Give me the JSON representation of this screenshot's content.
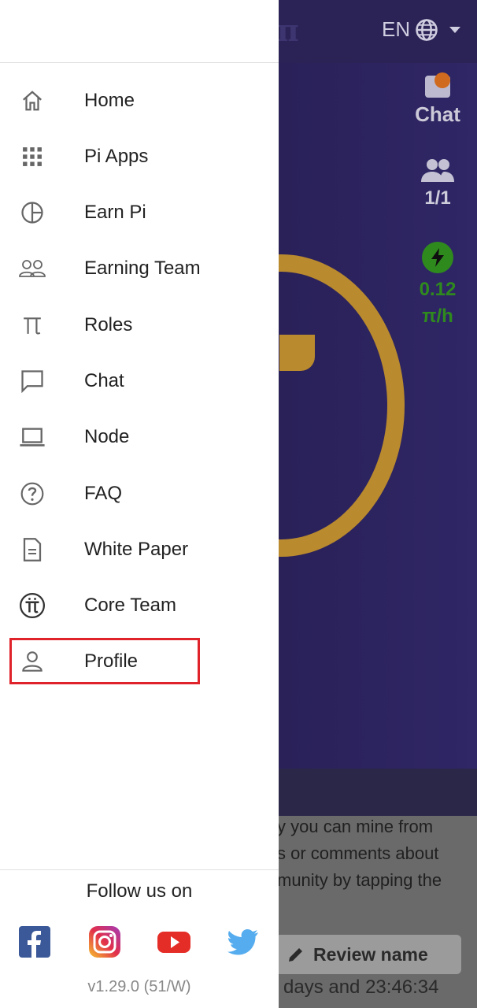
{
  "topbar": {
    "language": "EN"
  },
  "stats": {
    "chat_label": "Chat",
    "team_count": "1/1",
    "rate_value": "0.12",
    "rate_unit": "π/h"
  },
  "bottom": {
    "lines": [
      "y you can mine from",
      "s or comments about",
      "munity by tapping the"
    ],
    "review_label": "Review name",
    "countdown": "days and 23:46:34"
  },
  "drawer": {
    "items": [
      {
        "label": "Home",
        "icon": "home-icon"
      },
      {
        "label": "Pi Apps",
        "icon": "grid-icon"
      },
      {
        "label": "Earn Pi",
        "icon": "pie-icon"
      },
      {
        "label": "Earning Team",
        "icon": "team-icon"
      },
      {
        "label": "Roles",
        "icon": "pi-icon"
      },
      {
        "label": "Chat",
        "icon": "chat-icon"
      },
      {
        "label": "Node",
        "icon": "laptop-icon"
      },
      {
        "label": "FAQ",
        "icon": "question-icon"
      },
      {
        "label": "White Paper",
        "icon": "document-icon"
      },
      {
        "label": "Core Team",
        "icon": "pi-coin-icon"
      },
      {
        "label": "Profile",
        "icon": "person-icon"
      }
    ],
    "follow_title": "Follow us on",
    "version": "v1.29.0 (51/W)"
  },
  "colors": {
    "highlight": "#e0222a",
    "accent_gold": "#b98a2e",
    "mining_green": "#2f8a1e"
  }
}
